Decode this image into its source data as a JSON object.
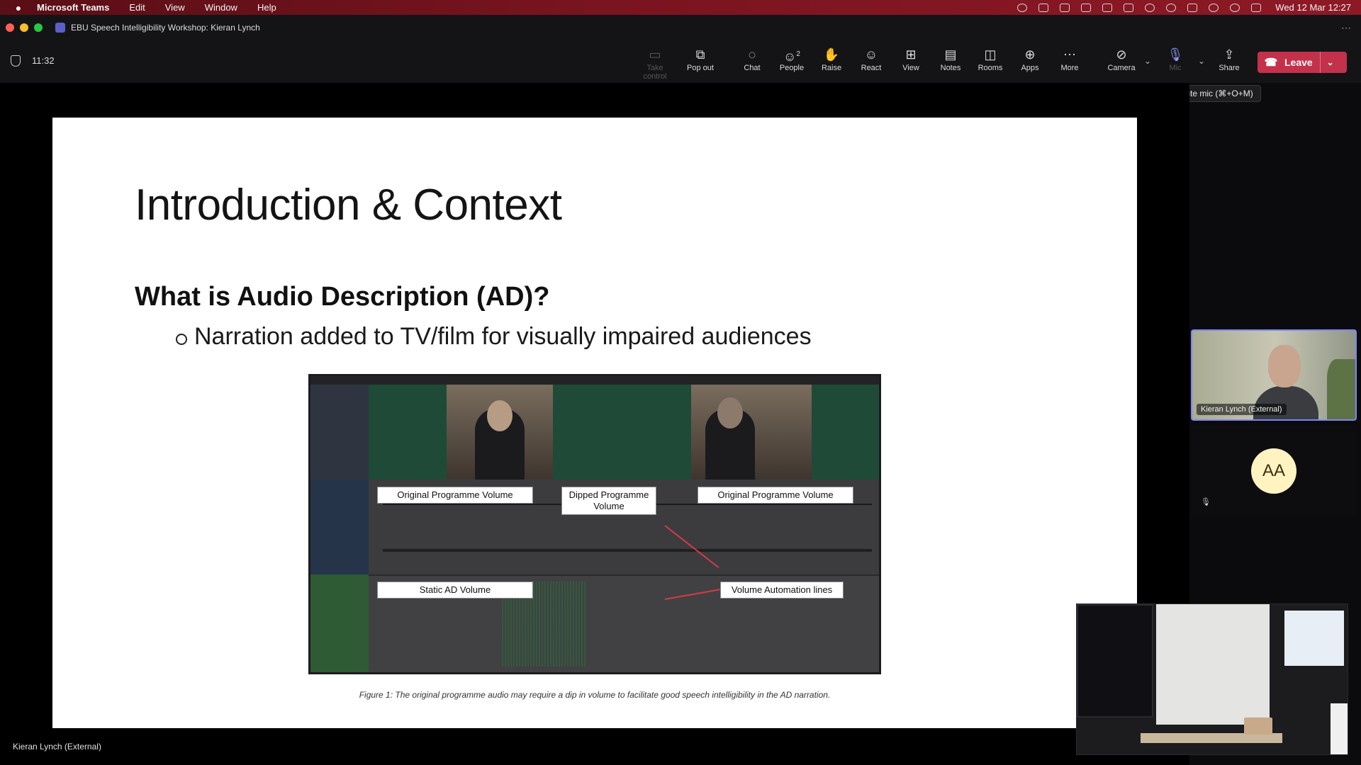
{
  "menubar": {
    "app_name": "Microsoft Teams",
    "menus": [
      "Edit",
      "View",
      "Window",
      "Help"
    ],
    "clock": "Wed 12 Mar  12:27"
  },
  "window": {
    "title": "EBU Speech Intelligibility Workshop: Kieran Lynch"
  },
  "meeting": {
    "duration": "11:32",
    "buttons": {
      "take_control": "Take control",
      "pop_out": "Pop out",
      "chat": "Chat",
      "people": "People",
      "people_count": "2",
      "raise": "Raise",
      "react": "React",
      "view": "View",
      "notes": "Notes",
      "rooms": "Rooms",
      "apps": "Apps",
      "more": "More",
      "camera": "Camera",
      "mic": "Mic",
      "share": "Share",
      "leave": "Leave"
    },
    "tooltip": "Unmute mic (⌘+O+M)",
    "colors": {
      "leave": "#c4314b",
      "accent": "#7f85f5"
    }
  },
  "slide": {
    "title": "Introduction & Context",
    "heading": "What is Audio Description (AD)?",
    "bullet": "Narration added to TV/film for visually impaired audiences",
    "figure_labels": {
      "original_1": "Original Programme Volume",
      "dipped": "Dipped Programme Volume",
      "original_2": "Original Programme Volume",
      "static_ad": "Static AD Volume",
      "automation": "Volume Automation lines"
    },
    "caption": "Figure 1: The original programme audio may require a dip in volume to facilitate good speech intelligibility in the AD narration."
  },
  "participants": [
    {
      "name": "Kieran Lynch (External)"
    },
    {
      "initials": "AA"
    }
  ],
  "presenter_label": "Kieran Lynch (External)"
}
